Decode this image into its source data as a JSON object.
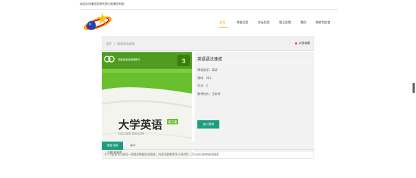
{
  "header": {
    "welcome_text": "欢迎访问课程资源共享在线课程系统！"
  },
  "nav": {
    "items": [
      {
        "label": "首页",
        "active": true
      },
      {
        "label": "课程信息",
        "active": false
      },
      {
        "label": "论坛信息",
        "active": false
      },
      {
        "label": "留言反馈",
        "active": false
      },
      {
        "label": "我的",
        "active": false
      },
      {
        "label": "跳转到后台",
        "active": false
      }
    ],
    "accent_color": "#f39800"
  },
  "breadcrumb": {
    "home": "首页",
    "separator": "/",
    "current": "英语语法速成"
  },
  "favorite": {
    "label": "点我收藏"
  },
  "course": {
    "title": "英语语法速成",
    "type_label": "课程类型：",
    "type_value": "英语",
    "hours_label": "课时：",
    "hours_value": "111",
    "credit_label": "学分：",
    "credit_value": "1",
    "teacher_label": "教师姓名：",
    "teacher_value": "王老师",
    "join_label": "加入课程",
    "button_color": "#1a9e7e"
  },
  "cover": {
    "title": "大学英语",
    "volume": "第三册",
    "subtitle": "COLLEGE ENGLISH",
    "series": "国家级精品课程教材",
    "author": "主编 刘老师"
  },
  "tabs": [
    {
      "label": "课程详情",
      "active": true
    },
    {
      "label": "评价",
      "active": false
    }
  ],
  "intro": {
    "text": "1111这里可以放另一段相关数据信息描述，内容主要都是用于测试的，可以自行修改该段描述"
  }
}
